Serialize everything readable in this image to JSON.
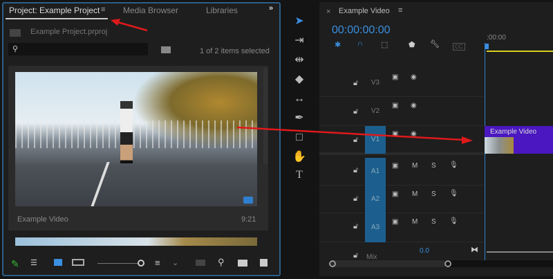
{
  "project": {
    "tabs": [
      "Project: Example Project",
      "Media Browser",
      "Libraries"
    ],
    "file": "Example Project.prproj",
    "search_placeholder": "",
    "selection": "1 of 2 items selected",
    "clip_name": "Example Video",
    "clip_duration": "9:21"
  },
  "timeline": {
    "sequence": "Example Video",
    "timecode": "00:00:00:00",
    "ruler": ":00:00",
    "clip_label": "Example Video",
    "mix_value": "0.0",
    "video_tracks": [
      "V3",
      "V2",
      "V1"
    ],
    "audio_tracks": [
      "A1",
      "A2",
      "A3"
    ],
    "mix_label": "Mix",
    "mute": "M",
    "solo": "S",
    "cc": "CC"
  },
  "colors": {
    "accent": "#2f7fd0",
    "clip": "#4a17c0",
    "annotation": "#e0191b"
  }
}
